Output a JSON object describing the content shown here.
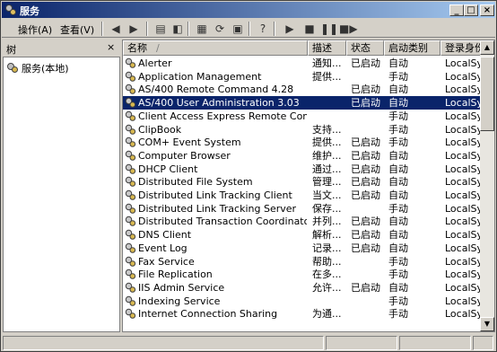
{
  "window": {
    "title": "服务",
    "controls": [
      "_",
      "□",
      "×"
    ]
  },
  "menu": [
    {
      "label": "操作(A)"
    },
    {
      "label": "查看(V)"
    }
  ],
  "left_pane": {
    "header": "树",
    "tree_item": "服务(本地)"
  },
  "columns": [
    "名称",
    "描述",
    "状态",
    "启动类别",
    "登录身份"
  ],
  "rows": [
    {
      "name": "Alerter",
      "desc": "通知...",
      "status": "已启动",
      "startup": "自动",
      "logon": "LocalSystem"
    },
    {
      "name": "Application Management",
      "desc": "提供...",
      "status": "",
      "startup": "手动",
      "logon": "LocalSystem"
    },
    {
      "name": "AS/400 Remote Command 4.28",
      "desc": "",
      "status": "已启动",
      "startup": "自动",
      "logon": "LocalSystem"
    },
    {
      "name": "AS/400 User Administration 3.03",
      "desc": "",
      "status": "已启动",
      "startup": "自动",
      "logon": "LocalSystem",
      "selected": true
    },
    {
      "name": "Client Access Express Remote Command",
      "desc": "",
      "status": "",
      "startup": "手动",
      "logon": "LocalSystem"
    },
    {
      "name": "ClipBook",
      "desc": "支持...",
      "status": "",
      "startup": "手动",
      "logon": "LocalSystem"
    },
    {
      "name": "COM+ Event System",
      "desc": "提供...",
      "status": "已启动",
      "startup": "手动",
      "logon": "LocalSystem"
    },
    {
      "name": "Computer Browser",
      "desc": "维护...",
      "status": "已启动",
      "startup": "自动",
      "logon": "LocalSystem"
    },
    {
      "name": "DHCP Client",
      "desc": "通过...",
      "status": "已启动",
      "startup": "自动",
      "logon": "LocalSystem"
    },
    {
      "name": "Distributed File System",
      "desc": "管理...",
      "status": "已启动",
      "startup": "自动",
      "logon": "LocalSystem"
    },
    {
      "name": "Distributed Link Tracking Client",
      "desc": "当文...",
      "status": "已启动",
      "startup": "自动",
      "logon": "LocalSystem"
    },
    {
      "name": "Distributed Link Tracking Server",
      "desc": "保存...",
      "status": "",
      "startup": "手动",
      "logon": "LocalSystem"
    },
    {
      "name": "Distributed Transaction Coordinator",
      "desc": "并列...",
      "status": "已启动",
      "startup": "自动",
      "logon": "LocalSystem"
    },
    {
      "name": "DNS Client",
      "desc": "解析...",
      "status": "已启动",
      "startup": "自动",
      "logon": "LocalSystem"
    },
    {
      "name": "Event Log",
      "desc": "记录...",
      "status": "已启动",
      "startup": "自动",
      "logon": "LocalSystem"
    },
    {
      "name": "Fax Service",
      "desc": "帮助...",
      "status": "",
      "startup": "手动",
      "logon": "LocalSystem"
    },
    {
      "name": "File Replication",
      "desc": "在多...",
      "status": "",
      "startup": "手动",
      "logon": "LocalSystem"
    },
    {
      "name": "IIS Admin Service",
      "desc": "允许...",
      "status": "已启动",
      "startup": "自动",
      "logon": "LocalSystem"
    },
    {
      "name": "Indexing Service",
      "desc": "",
      "status": "",
      "startup": "手动",
      "logon": "LocalSystem"
    },
    {
      "name": "Internet Connection Sharing",
      "desc": "为通...",
      "status": "",
      "startup": "手动",
      "logon": "LocalSystem"
    }
  ],
  "colors": {
    "selection": "#0a246a",
    "titlebar_start": "#0a246a",
    "titlebar_end": "#a6caf0",
    "chrome": "#d4d0c8"
  }
}
